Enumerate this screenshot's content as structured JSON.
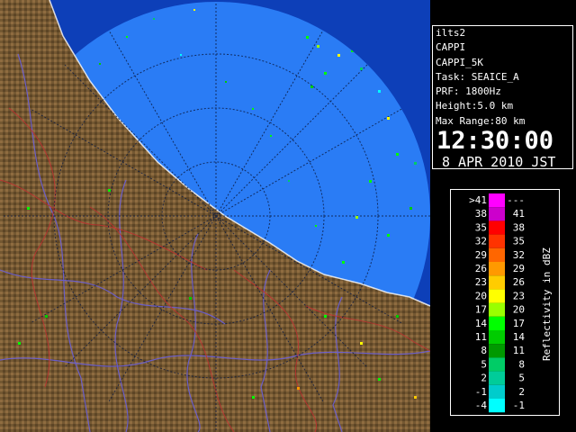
{
  "info": {
    "station": "ilts2",
    "product": "CAPPI",
    "product_variant": "CAPPI_5K",
    "task": "Task: SEAICE_A",
    "prf": "PRF: 1800Hz",
    "height": "Height:5.0 km",
    "max_range": "Max Range:80 km",
    "time": "12:30:00",
    "date": "8 APR 2010 JST"
  },
  "legend": {
    "title": "Reflectivity in dBZ",
    "bins": [
      {
        "left": ">41",
        "right": "---",
        "color": "#ff00ff"
      },
      {
        "left": "38",
        "right": "41",
        "color": "#cc00cc"
      },
      {
        "left": "35",
        "right": "38",
        "color": "#ff0000"
      },
      {
        "left": "32",
        "right": "35",
        "color": "#ff3300"
      },
      {
        "left": "29",
        "right": "32",
        "color": "#ff6600"
      },
      {
        "left": "26",
        "right": "29",
        "color": "#ff9900"
      },
      {
        "left": "23",
        "right": "26",
        "color": "#ffcc00"
      },
      {
        "left": "20",
        "right": "23",
        "color": "#ffff00"
      },
      {
        "left": "17",
        "right": "20",
        "color": "#99ff00"
      },
      {
        "left": "14",
        "right": "17",
        "color": "#00ff00"
      },
      {
        "left": "11",
        "right": "14",
        "color": "#00cc00"
      },
      {
        "left": "8",
        "right": "11",
        "color": "#009900"
      },
      {
        "left": "5",
        "right": "8",
        "color": "#00cc66"
      },
      {
        "left": "2",
        "right": "5",
        "color": "#00cc99"
      },
      {
        "left": "-1",
        "right": "2",
        "color": "#00cccc"
      },
      {
        "left": "-4",
        "right": "-1",
        "color": "#00ffff"
      }
    ]
  },
  "colors": {
    "sea": "#1f6cf0",
    "sea_inside": "#1a64e6",
    "land": "#8a6a3e",
    "river": "#6a5fd8",
    "boundary": "#c03030"
  }
}
